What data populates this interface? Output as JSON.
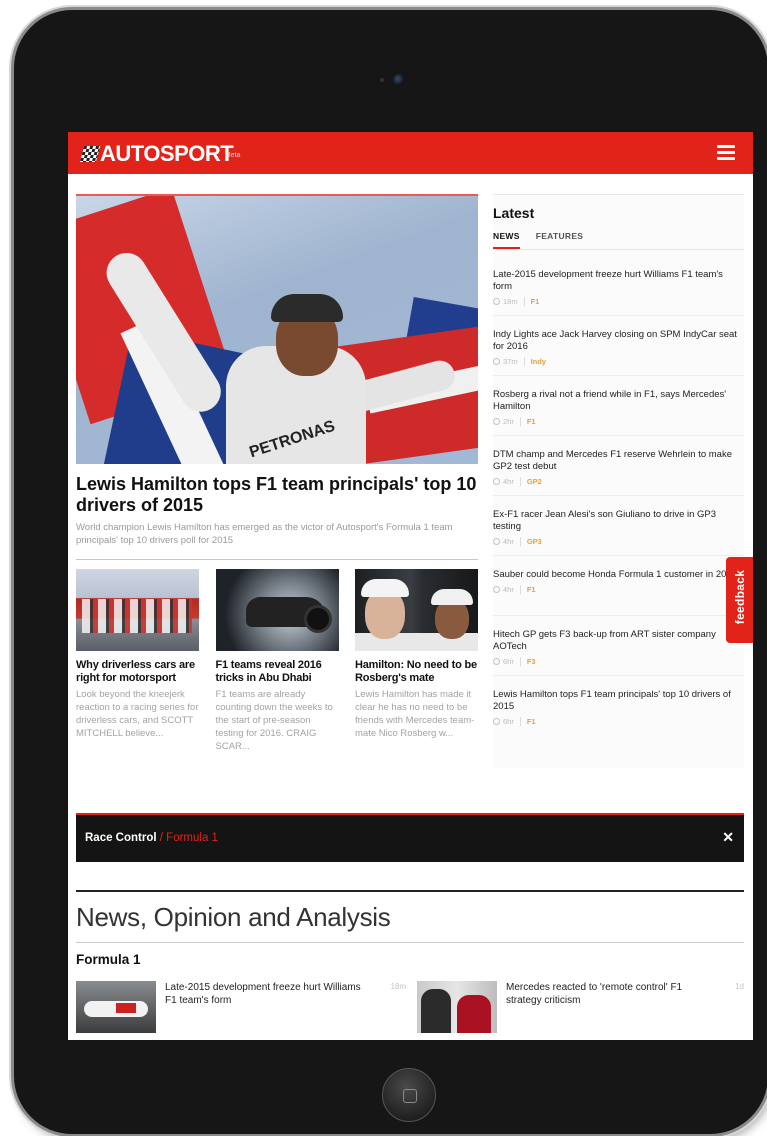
{
  "header": {
    "logo": "AUTOSPORT",
    "logo_badge": "Beta"
  },
  "hero": {
    "title": "Lewis Hamilton tops F1 team principals' top 10 drivers of 2015",
    "description": "World champion Lewis Hamilton has emerged as the victor of Autosport's Formula 1 team principals' top 10 drivers poll for 2015",
    "image_overlay_text": "PETRONAS"
  },
  "cards": [
    {
      "title": "Why driverless cars are right for motorsport",
      "description": "Look beyond the kneejerk reaction to a racing series for driverless cars, and SCOTT MITCHELL believe..."
    },
    {
      "title": "F1 teams reveal 2016 tricks in Abu Dhabi",
      "description": "F1 teams are already counting down the weeks to the start of pre-season testing for 2016. CRAIG SCAR..."
    },
    {
      "title": "Hamilton: No need to be Rosberg's mate",
      "description": "Lewis Hamilton has made it clear he has no need to be friends with Mercedes team-mate Nico Rosberg w..."
    }
  ],
  "sidebar": {
    "title": "Latest",
    "tabs": [
      "NEWS",
      "FEATURES"
    ],
    "active_tab": "NEWS",
    "items": [
      {
        "title": "Late-2015 development freeze hurt Williams F1 team's form",
        "time": "18m",
        "category": "F1"
      },
      {
        "title": "Indy Lights ace Jack Harvey closing on SPM IndyCar seat for 2016",
        "time": "37m",
        "category": "Indy"
      },
      {
        "title": "Rosberg a rival not a friend while in F1, says Mercedes' Hamilton",
        "time": "2hr",
        "category": "F1"
      },
      {
        "title": "DTM champ and Mercedes F1 reserve Wehrlein to make GP2 test debut",
        "time": "4hr",
        "category": "GP2"
      },
      {
        "title": "Ex-F1 racer Jean Alesi's son Giuliano to drive in GP3 testing",
        "time": "4hr",
        "category": "GP3"
      },
      {
        "title": "Sauber could become Honda Formula 1 customer in 2017",
        "time": "4hr",
        "category": "F1"
      },
      {
        "title": "Hitech GP gets F3 back-up from ART sister company AOTech",
        "time": "6hr",
        "category": "F3"
      },
      {
        "title": "Lewis Hamilton tops F1 team principals' top 10 drivers of 2015",
        "time": "6hr",
        "category": "F1"
      }
    ]
  },
  "feedback": {
    "label": "feedback"
  },
  "race_control": {
    "label": "Race Control",
    "separator": " / ",
    "sub_label": "Formula 1",
    "close": "✕"
  },
  "news_section": {
    "title": "News, Opinion and Analysis",
    "subsection": "Formula 1",
    "stories": [
      {
        "title": "Late-2015 development freeze hurt Williams F1 team's form",
        "time": "18m"
      },
      {
        "title": "Mercedes reacted to 'remote control' F1 strategy criticism",
        "time": "1d"
      }
    ]
  },
  "colors": {
    "brand_red": "#e2231a",
    "category_orange": "#f0a030",
    "race_control_bg": "#141414"
  }
}
